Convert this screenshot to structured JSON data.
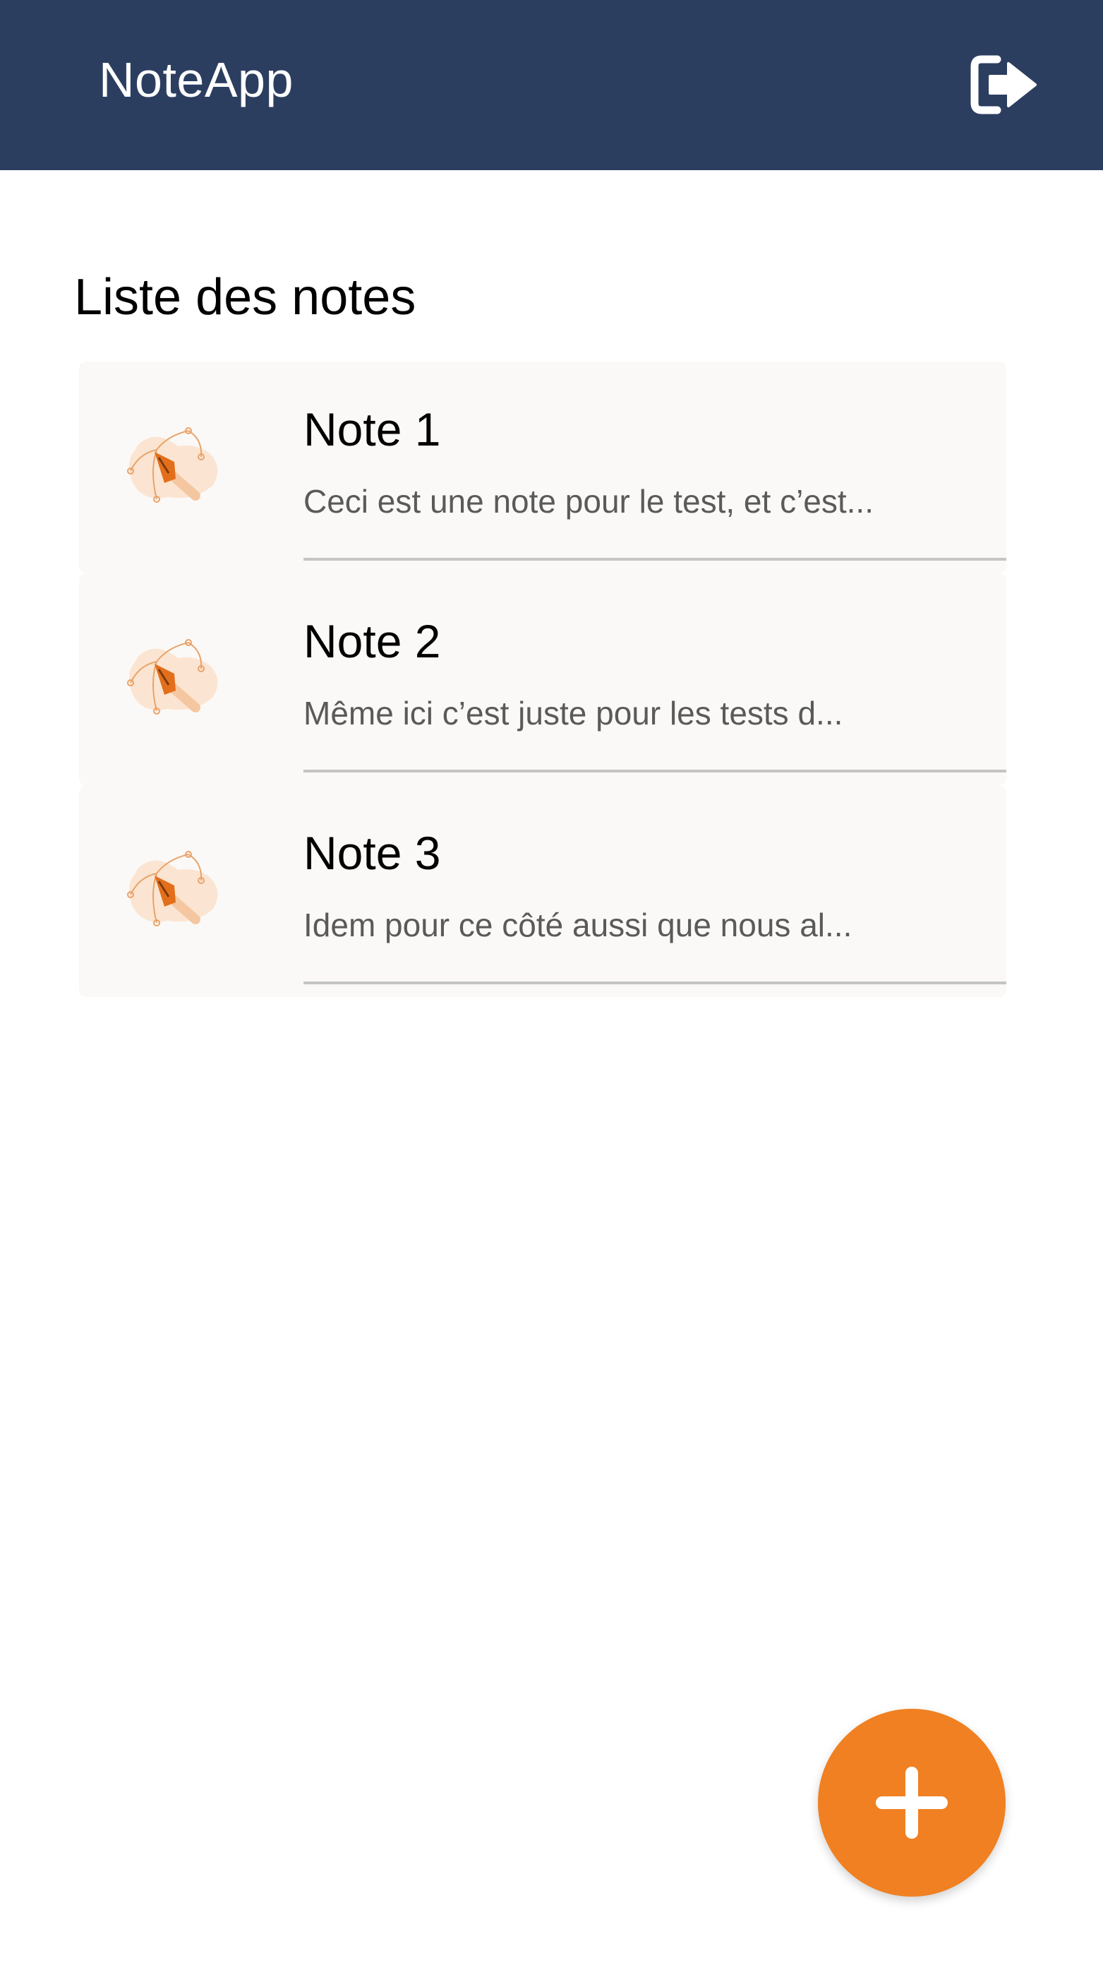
{
  "app_bar": {
    "title": "NoteApp",
    "logout_icon": "logout-icon"
  },
  "page": {
    "heading": "Liste des notes"
  },
  "notes": [
    {
      "title": "Note 1",
      "preview": "Ceci est une note pour le test, et c’est...",
      "icon": "pen-tool-icon"
    },
    {
      "title": "Note 2",
      "preview": "Même ici c’est juste pour les tests d...",
      "icon": "pen-tool-icon"
    },
    {
      "title": "Note 3",
      "preview": "Idem pour ce côté aussi que nous al...",
      "icon": "pen-tool-icon"
    }
  ],
  "fab": {
    "icon": "plus-icon"
  },
  "colors": {
    "app_bar": "#2c3e60",
    "accent": "#f08021",
    "card_bg": "#fbf9f7"
  }
}
